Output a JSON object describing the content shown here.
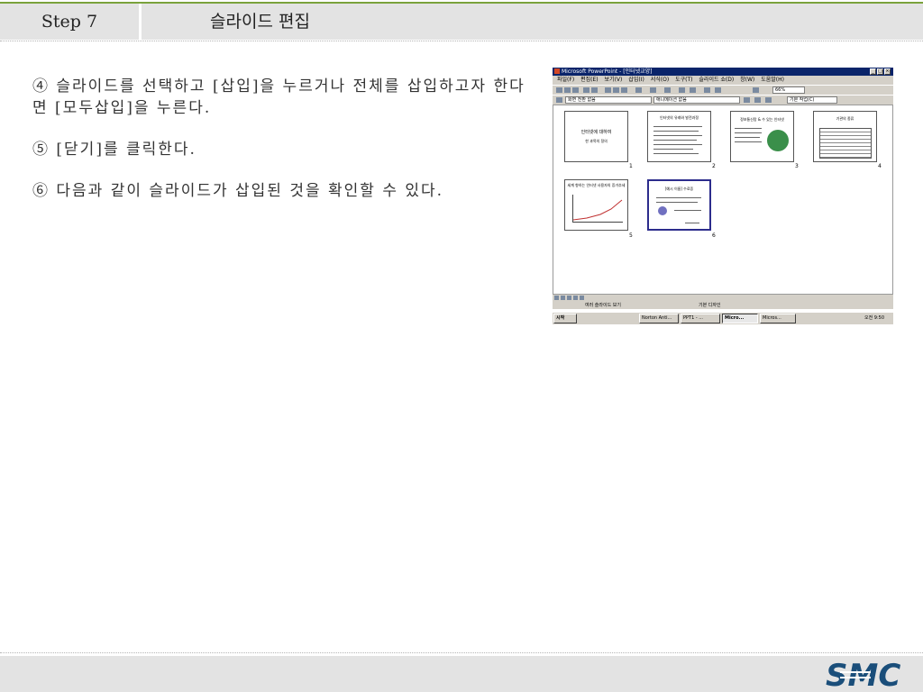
{
  "header": {
    "step": "Step 7",
    "title": "슬라이드 편집"
  },
  "instructions": [
    "④ 슬라이드를 선택하고 [삽입]을 누르거나 전체를 삽입하고자 한다면 [모두삽입]을 누른다.",
    "⑤ [닫기]를 클릭한다.",
    "⑥ 다음과 같이 슬라이드가 삽입된 것을 확인할 수 있다."
  ],
  "screenshot": {
    "title": "Microsoft PowerPoint - [인터넷교양]",
    "menus": [
      "파일(F)",
      "편집(E)",
      "보기(V)",
      "삽입(I)",
      "서식(O)",
      "도구(T)",
      "슬라이드 쇼(D)",
      "창(W)",
      "도움말(H)"
    ],
    "zoom": "66%",
    "transition": "화면 전환 없음",
    "animation": "애니메이션 없음",
    "common_tasks": "기본 작업(C)",
    "slides": [
      {
        "num": "1",
        "title": "인터넷에 대하여",
        "subtitle": "한 과목의 정의"
      },
      {
        "num": "2",
        "title": "인터넷의 유래와 발전과정"
      },
      {
        "num": "3",
        "title": "정보통신망 & 수 있는 인터넷"
      },
      {
        "num": "4",
        "title": "기관의 종류"
      },
      {
        "num": "5",
        "title": "세계 향하는 인터넷 사용자의 증가추세"
      },
      {
        "num": "6",
        "title": "[예시 이름] 수료증"
      }
    ],
    "status_left": "여러 슬라이드 보기",
    "status_right": "기본 디자인",
    "taskbar": {
      "start": "시작",
      "items": [
        "Norton Anti...",
        "PPT1 - ...",
        "Micro...",
        "Micros..."
      ],
      "clock": "오전 9:50"
    }
  },
  "footer": {
    "logo": "SMC"
  }
}
